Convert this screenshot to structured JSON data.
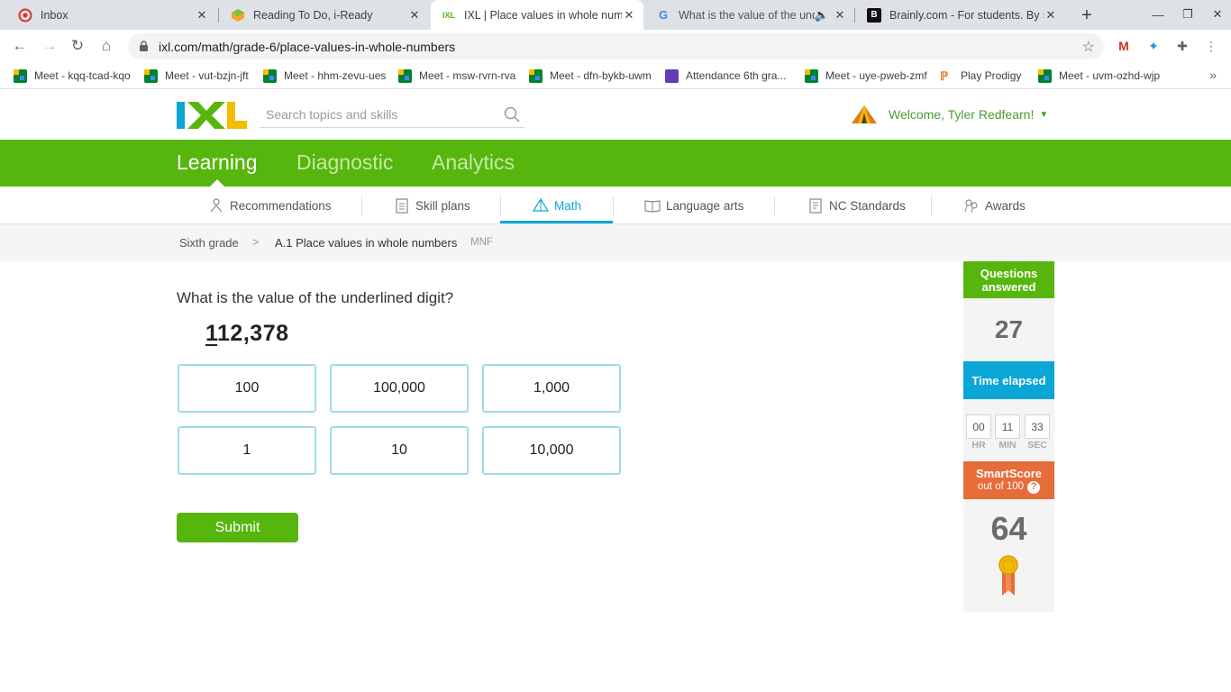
{
  "browser": {
    "tabs": [
      {
        "title": "Inbox",
        "icon": "gmail-icon"
      },
      {
        "title": "Reading To Do, i-Ready",
        "icon": "iready-icon"
      },
      {
        "title": "IXL | Place values in whole num",
        "icon": "ixl-icon"
      },
      {
        "title": "What is the value of the und",
        "icon": "google-icon"
      },
      {
        "title": "Brainly.com - For students. By st",
        "icon": "brainly-icon"
      }
    ],
    "url": "ixl.com/math/grade-6/place-values-in-whole-numbers",
    "bookmarks": [
      "Meet - kqq-tcad-kqo",
      "Meet - vut-bzjn-jft",
      "Meet - hhm-zevu-ues",
      "Meet - msw-rvrn-rva",
      "Meet - dfn-bykb-uwm",
      "Attendance 6th gra...",
      "Meet - uye-pweb-zmf",
      "Play Prodigy",
      "Meet - uvm-ozhd-wjp"
    ]
  },
  "header": {
    "search_placeholder": "Search topics and skills",
    "welcome": "Welcome, Tyler Redfearn!"
  },
  "main_nav": [
    "Learning",
    "Diagnostic",
    "Analytics"
  ],
  "sub_nav": [
    "Recommendations",
    "Skill plans",
    "Math",
    "Language arts",
    "NC Standards",
    "Awards"
  ],
  "breadcrumb": {
    "grade": "Sixth grade",
    "skill": "A.1 Place values in whole numbers",
    "code": "MNF"
  },
  "question": {
    "prompt": "What is the value of the underlined digit?",
    "number_underlined": "1",
    "number_rest": "12,378",
    "choices": [
      "100",
      "100,000",
      "1,000",
      "1",
      "10",
      "10,000"
    ],
    "submit_label": "Submit"
  },
  "side_panel": {
    "questions_answered_label": "Questions answered",
    "questions_answered": "27",
    "time_label": "Time elapsed",
    "time": {
      "hr": "00",
      "min": "11",
      "sec": "33"
    },
    "time_units": {
      "hr": "HR",
      "min": "MIN",
      "sec": "SEC"
    },
    "smartscore_label": "SmartScore",
    "smartscore_sub": "out of 100",
    "smartscore": "64"
  },
  "colors": {
    "ixl_green": "#56b60d",
    "ixl_blue": "#0aa6d6",
    "smartscore_orange": "#e66c3a"
  }
}
